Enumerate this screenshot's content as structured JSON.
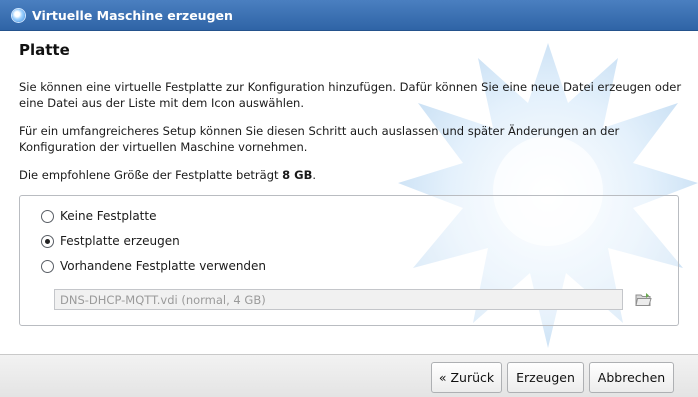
{
  "window": {
    "title": "Virtuelle Maschine erzeugen"
  },
  "page": {
    "heading": "Platte",
    "para1": "Sie können eine virtuelle Festplatte zur Konfiguration hinzufügen. Dafür können Sie eine neue Datei erzeugen oder eine Datei aus der Liste mit dem Icon auswählen.",
    "para2": "Für ein umfangreicheres Setup können Sie diesen Schritt auch auslassen und später Änderungen an der Konfiguration der virtuellen Maschine vornehmen.",
    "para3_prefix": "Die empfohlene Größe der Festplatte beträgt ",
    "para3_size": "8 GB",
    "para3_suffix": "."
  },
  "disk_options": {
    "options": [
      {
        "label": "Keine Festplatte",
        "selected": false
      },
      {
        "label": "Festplatte erzeugen",
        "selected": true
      },
      {
        "label": "Vorhandene Festplatte verwenden",
        "selected": false
      }
    ],
    "existing_file_value": "DNS-DHCP-MQTT.vdi (normal, 4 GB)",
    "existing_file_enabled": false,
    "folder_icon": "folder-open-icon"
  },
  "buttons": {
    "back": "« Zurück",
    "create": "Erzeugen",
    "cancel": "Abbrechen"
  },
  "colors": {
    "titlebar": "#3a6fb2",
    "title_text": "#ffffff",
    "footer": "#e9e9e9"
  }
}
